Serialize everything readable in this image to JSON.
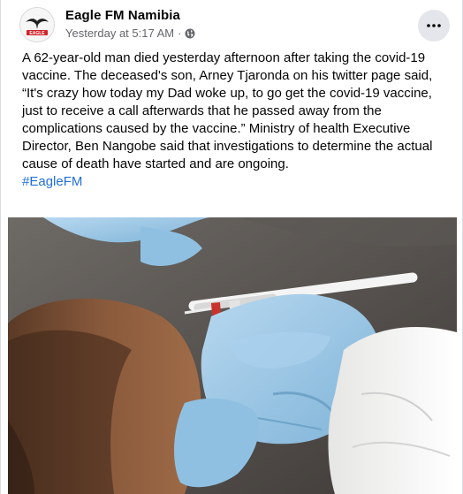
{
  "post": {
    "page_name": "Eagle FM Namibia",
    "timestamp": "Yesterday at 5:17 AM",
    "separator": "·",
    "privacy_icon": "globe-icon",
    "more_icon": "ellipsis-icon",
    "avatar_text": "EAGLE",
    "body": "A 62-year-old man died yesterday afternoon after taking the covid-19 vaccine. The deceased's son, Arney Tjaronda on his twitter page said, “It's crazy how today my Dad woke up, to go get the covid-19 vaccine, just to receive a call afterwards that he passed away from the complications caused by the vaccine.” Ministry of health Executive Director, Ben Nangobe said that investigations to determine the actual cause of death have started and are ongoing.",
    "hashtag": "#EagleFM"
  },
  "colors": {
    "hashtag": "#216fdb",
    "meta_text": "#65676b",
    "glove": "#9cc7e6",
    "brand_red": "#d2232a"
  }
}
